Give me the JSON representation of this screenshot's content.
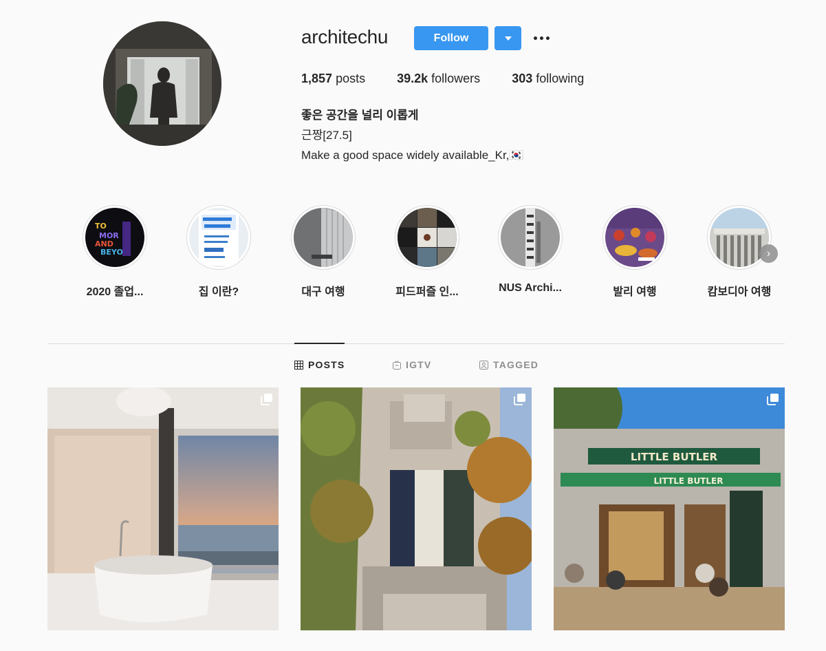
{
  "profile": {
    "username": "architechu",
    "follow_label": "Follow",
    "stats": {
      "posts_count": "1,857",
      "posts_label": "posts",
      "followers_count": "39.2k",
      "followers_label": "followers",
      "following_count": "303",
      "following_label": "following"
    },
    "bio": {
      "name": "좋은 공간을 널리 이롭게",
      "line1": "근짱[27.5]",
      "line2": "Make a good space widely available_Kr,🇰🇷"
    }
  },
  "highlights": [
    {
      "label": "2020 졸업..."
    },
    {
      "label": "집 이란?"
    },
    {
      "label": "대구 여행"
    },
    {
      "label": "피드퍼즐 인..."
    },
    {
      "label": "NUS Archi..."
    },
    {
      "label": "발리 여행"
    },
    {
      "label": "캄보디아 여행"
    }
  ],
  "tabs": {
    "posts": "POSTS",
    "igtv": "IGTV",
    "tagged": "TAGGED"
  },
  "colors": {
    "accent": "#3897f0",
    "background": "#fafafa",
    "text": "#262626",
    "muted": "#8e8e8e",
    "border": "#dbdbdb"
  }
}
